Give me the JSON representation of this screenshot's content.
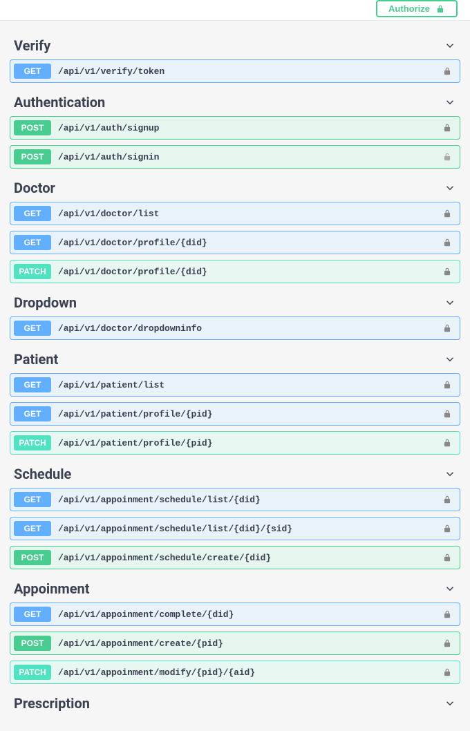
{
  "authorize_label": "Authorize",
  "sections": [
    {
      "title": "Verify",
      "endpoints": [
        {
          "method": "GET",
          "path": "/api/v1/verify/token",
          "locked": true
        }
      ]
    },
    {
      "title": "Authentication",
      "endpoints": [
        {
          "method": "POST",
          "path": "/api/v1/auth/signup",
          "locked": true
        },
        {
          "method": "POST",
          "path": "/api/v1/auth/signin",
          "locked": false
        }
      ]
    },
    {
      "title": "Doctor",
      "endpoints": [
        {
          "method": "GET",
          "path": "/api/v1/doctor/list",
          "locked": true
        },
        {
          "method": "GET",
          "path": "/api/v1/doctor/profile/{did}",
          "locked": true
        },
        {
          "method": "PATCH",
          "path": "/api/v1/doctor/profile/{did}",
          "locked": true
        }
      ]
    },
    {
      "title": "Dropdown",
      "endpoints": [
        {
          "method": "GET",
          "path": "/api/v1/doctor/dropdowninfo",
          "locked": true
        }
      ]
    },
    {
      "title": "Patient",
      "endpoints": [
        {
          "method": "GET",
          "path": "/api/v1/patient/list",
          "locked": true
        },
        {
          "method": "GET",
          "path": "/api/v1/patient/profile/{pid}",
          "locked": true
        },
        {
          "method": "PATCH",
          "path": "/api/v1/patient/profile/{pid}",
          "locked": true
        }
      ]
    },
    {
      "title": "Schedule",
      "endpoints": [
        {
          "method": "GET",
          "path": "/api/v1/appoinment/schedule/list/{did}",
          "locked": true
        },
        {
          "method": "GET",
          "path": "/api/v1/appoinment/schedule/list/{did}/{sid}",
          "locked": true
        },
        {
          "method": "POST",
          "path": "/api/v1/appoinment/schedule/create/{did}",
          "locked": true
        }
      ]
    },
    {
      "title": "Appoinment",
      "endpoints": [
        {
          "method": "GET",
          "path": "/api/v1/appoinment/complete/{did}",
          "locked": true
        },
        {
          "method": "POST",
          "path": "/api/v1/appoinment/create/{pid}",
          "locked": true
        },
        {
          "method": "PATCH",
          "path": "/api/v1/appoinment/modify/{pid}/{aid}",
          "locked": true
        }
      ]
    },
    {
      "title": "Prescription",
      "endpoints": []
    }
  ]
}
